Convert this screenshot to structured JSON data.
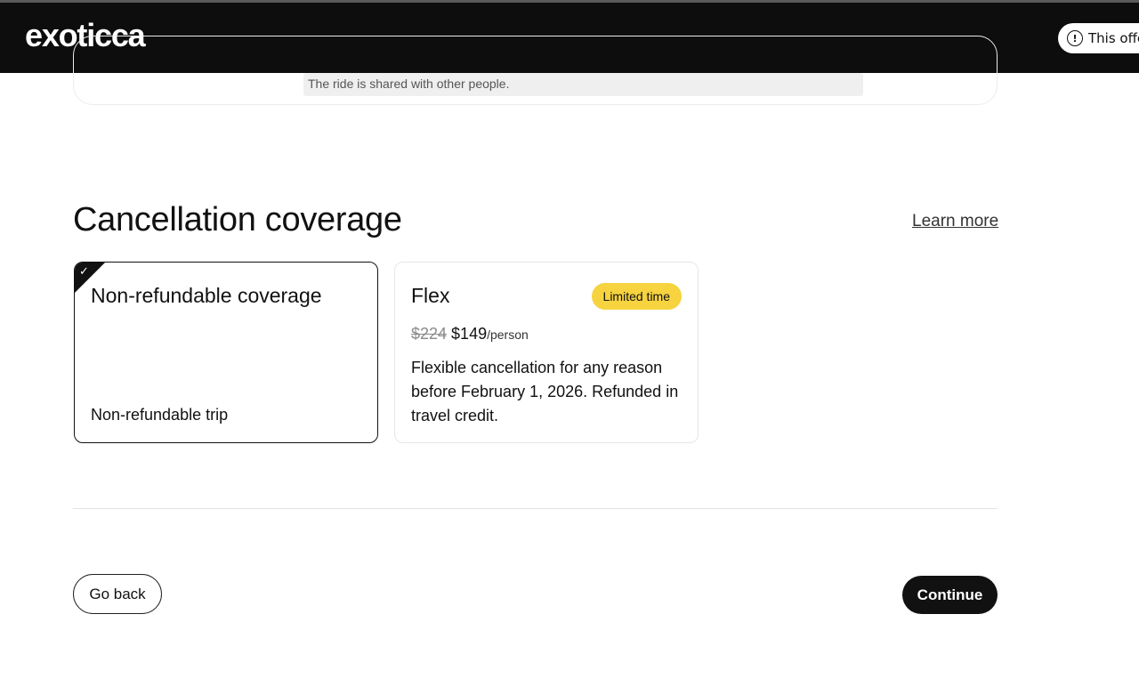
{
  "header": {
    "logo": "exoticca",
    "offer_text": "This offer"
  },
  "previous_section": {
    "note": "The ride is shared with other people."
  },
  "cancellation": {
    "title": "Cancellation coverage",
    "learn_more": "Learn more",
    "options": [
      {
        "title": "Non-refundable coverage",
        "footer": "Non-refundable trip",
        "selected": true
      },
      {
        "title": "Flex",
        "badge": "Limited time",
        "old_price": "$224",
        "new_price": "$149",
        "per": "/person",
        "description": "Flexible cancellation for any reason before February 1, 2026. Refunded in travel credit.",
        "selected": false
      }
    ]
  },
  "footer": {
    "back_label": "Go back",
    "continue_label": "Continue"
  },
  "colors": {
    "header_bg": "#0d0d0d",
    "badge_bg": "#f6d33f",
    "primary_button": "#111111"
  }
}
